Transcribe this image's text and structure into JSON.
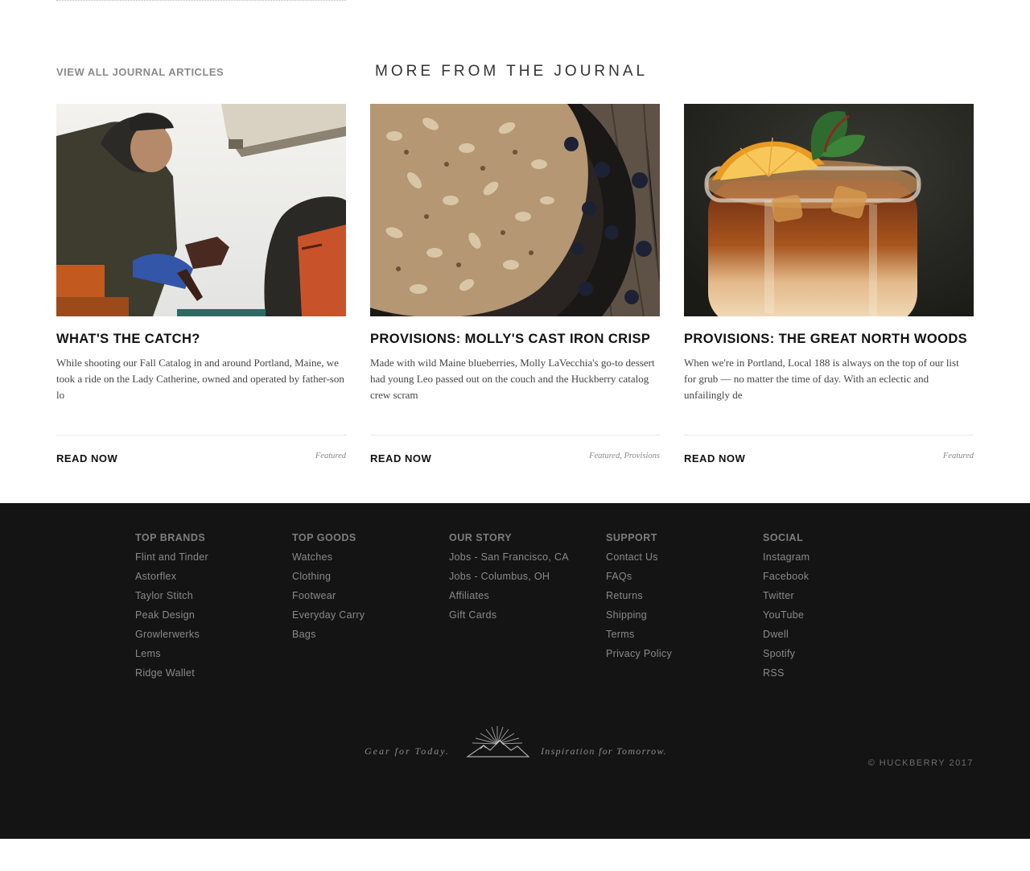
{
  "journal": {
    "view_all_label": "VIEW ALL JOURNAL ARTICLES",
    "section_title": "MORE FROM THE JOURNAL",
    "articles": [
      {
        "title": "WHAT'S THE CATCH?",
        "excerpt": "While shooting our Fall Catalog in and around Portland, Maine, we took a ride on the Lady Catherine, owned and operated by father-son lo",
        "cta": "READ NOW",
        "tags": "Featured",
        "image": "lobster-fisherman-photo"
      },
      {
        "title": "PROVISIONS: MOLLY'S CAST IRON CRISP",
        "excerpt": "Made with wild Maine blueberries, Molly LaVecchia's go-to dessert had young Leo passed out on the couch and the Huckberry catalog crew scram",
        "cta": "READ NOW",
        "tags": "Featured, Provisions",
        "image": "blueberry-crisp-skillet-photo"
      },
      {
        "title": "PROVISIONS: THE GREAT NORTH WOODS",
        "excerpt": "When we're in Portland, Local 188 is always on the top of our list for grub — no matter the time of day. With an eclectic and unfailingly de",
        "cta": "READ NOW",
        "tags": "Featured",
        "image": "iced-cocktail-jar-photo"
      }
    ]
  },
  "footer": {
    "columns": [
      {
        "heading": "TOP BRANDS",
        "links": [
          "Flint and Tinder",
          "Astorflex",
          "Taylor Stitch",
          "Peak Design",
          "Growlerwerks",
          "Lems",
          "Ridge Wallet"
        ]
      },
      {
        "heading": "TOP GOODS",
        "links": [
          "Watches",
          "Clothing",
          "Footwear",
          "Everyday Carry",
          "Bags"
        ]
      },
      {
        "heading": "OUR STORY",
        "links": [
          "Jobs - San Francisco, CA",
          "Jobs - Columbus, OH",
          "Affiliates",
          "Gift Cards"
        ]
      },
      {
        "heading": "SUPPORT",
        "links": [
          "Contact Us",
          "FAQs",
          "Returns",
          "Shipping",
          "Terms",
          "Privacy Policy"
        ]
      },
      {
        "heading": "SOCIAL",
        "links": [
          "Instagram",
          "Facebook",
          "Twitter",
          "YouTube",
          "Dwell",
          "Spotify",
          "RSS"
        ]
      }
    ],
    "tagline_left": "Gear for Today.",
    "tagline_right": "Inspiration for Tomorrow.",
    "logo_icon": "mountain-sunburst-icon",
    "copyright": "© HUCKBERRY 2017"
  },
  "colors": {
    "footer_bg": "#141414",
    "footer_heading": "#7d7d7d",
    "footer_link": "#8a8a8a",
    "title_text": "#111111",
    "muted_text": "#8a8a8a"
  }
}
